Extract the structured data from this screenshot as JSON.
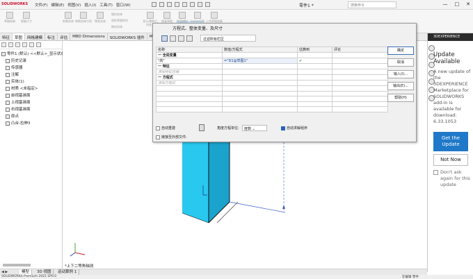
{
  "app": {
    "logo_text": "SOLIDWORKS",
    "menus": [
      "文件(F)",
      "编辑(E)",
      "视图(V)",
      "插入(I)",
      "工具(T)",
      "窗口(W)"
    ],
    "document_title": "零件1 *",
    "search_placeholder": "搜索命令",
    "window_controls": [
      "—",
      "□",
      "✕"
    ]
  },
  "ribbon": {
    "buttons": [
      "草图绘制",
      "智能尺寸",
      "剪裁实体",
      "转换实体引用",
      "等距实体",
      "镜向实体",
      "线性草图阵列",
      "显示/删除几何关系",
      "修复草图",
      "快速捕捉",
      "快速草图",
      "Instant2D",
      "上色草图轮廓"
    ],
    "small_items": [
      "镜向实体",
      "线性草图阵列",
      "移动实体"
    ],
    "selected_label": "Instant2D",
    "highlight_color": "#cde3f5"
  },
  "feature_tabs": {
    "items": [
      "特征",
      "草图",
      "网格建模",
      "标注",
      "评估",
      "MBD Dimensions",
      "SOLIDWORKS 插件",
      "MBD"
    ],
    "active_index": 1
  },
  "tree": {
    "root": "零件1 (默认) <<默认>_显示状态 1>",
    "items": [
      {
        "label": "历史记录",
        "icon": "history-icon"
      },
      {
        "label": "传感器",
        "icon": "sensor-icon"
      },
      {
        "label": "注解",
        "icon": "annotation-icon"
      },
      {
        "label": "实体(1)",
        "icon": "solid-body-icon"
      },
      {
        "label": "材质 <未指定>",
        "icon": "material-icon"
      },
      {
        "label": "前视基准面",
        "icon": "plane-icon"
      },
      {
        "label": "上视基准面",
        "icon": "plane-icon"
      },
      {
        "label": "右视基准面",
        "icon": "plane-icon"
      },
      {
        "label": "原点",
        "icon": "origin-icon"
      },
      {
        "label": "凸台-拉伸3",
        "icon": "extrude-icon"
      }
    ]
  },
  "dialog": {
    "header": "方程式、整体变量、及尺寸",
    "filter_placeholder": "过滤所有栏区",
    "columns": [
      "名称",
      "数值/方程式",
      "估算到",
      "评论"
    ],
    "rows": [
      {
        "type": "group",
        "name": "一 全局变量",
        "value": "",
        "eval": "",
        "comment": ""
      },
      {
        "type": "entry",
        "name": "\"高\"",
        "value": "=\"D1@草图1\"",
        "eval": "✔",
        "comment": ""
      },
      {
        "type": "group",
        "name": "一 特征",
        "value": "",
        "eval": "",
        "comment": ""
      },
      {
        "type": "add",
        "name": "添加特征压缩",
        "value": "",
        "eval": "",
        "comment": ""
      },
      {
        "type": "group",
        "name": "一 方程式",
        "value": "",
        "eval": "",
        "comment": ""
      },
      {
        "type": "add",
        "name": "添加方程式",
        "value": "",
        "eval": "",
        "comment": ""
      },
      {
        "type": "blank",
        "name": "",
        "value": "",
        "eval": "",
        "comment": ""
      },
      {
        "type": "blank",
        "name": "",
        "value": "",
        "eval": "",
        "comment": ""
      },
      {
        "type": "blank",
        "name": "",
        "value": "",
        "eval": "",
        "comment": ""
      },
      {
        "type": "blank",
        "name": "",
        "value": "",
        "eval": "",
        "comment": ""
      },
      {
        "type": "blank",
        "name": "",
        "value": "",
        "eval": "",
        "comment": ""
      }
    ],
    "buttons": [
      "确定",
      "取消",
      "输入(I)...",
      "输出(E)...",
      "帮助(H)"
    ],
    "auto_rebuild_label": "自动重建",
    "angle_unit_label": "角度方程单位:",
    "angle_unit_value": "度数",
    "auto_solve_label": "自动求解组序",
    "link_external_label": "链接至外部文件:"
  },
  "viewport": {
    "view_label": "*上下二等角轴测",
    "part_color": "#29c8ef",
    "part_shade_color": "#1aa3cc"
  },
  "right_panel": {
    "header": "3DEXPERIENCE",
    "title": "Update Available",
    "message": "A new update of the 3DEXPERIENCE Marketplace for SOLIDWORKS add-in is available for download: 6.33.1053",
    "get_update_label": "Get the Update",
    "not_now_label": "Not Now",
    "dont_ask_label": "Don't ask again for this update",
    "accent_color": "#1f78c8"
  },
  "bottom_tabs": {
    "arrows": "◀ ▶",
    "items": [
      "模型",
      "3D 视图",
      "运动算例 1"
    ],
    "active_index": 0
  },
  "status": {
    "left": "SOLIDWORKS Premium 2021 SP0.0",
    "right": "在编辑 零件"
  }
}
